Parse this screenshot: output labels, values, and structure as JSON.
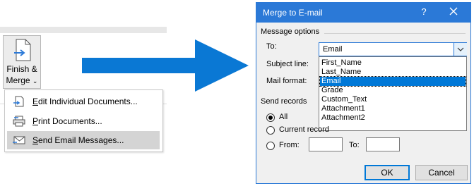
{
  "ribbon": {
    "finish_merge": {
      "label_line1": "Finish &",
      "label_line2": "Merge",
      "chevron": "⌄",
      "icon": "finish-merge-icon"
    },
    "menu": [
      {
        "label": "Edit Individual Documents...",
        "underline": "E",
        "icon": "edit-document-icon",
        "highlighted": false
      },
      {
        "label": "Print Documents...",
        "underline": "P",
        "icon": "printer-icon",
        "highlighted": false
      },
      {
        "label": "Send Email Messages...",
        "underline": "S",
        "icon": "envelope-icon",
        "highlighted": true
      }
    ]
  },
  "arrow": {
    "color": "#0a78d4",
    "icon": "right-arrow"
  },
  "dialog": {
    "title": "Merge to E-mail",
    "help": "?",
    "titlebar_color": "#2b79d7",
    "message_options_label": "Message options",
    "to_label": "To:",
    "to_value": "Email",
    "subject_label": "Subject line:",
    "mail_format_label": "Mail format:",
    "fields": [
      "First_Name",
      "Last_Name",
      "Email",
      "Grade",
      "Custom_Text",
      "Attachment1",
      "Attachment2"
    ],
    "selected_field": "Email",
    "send_records_label": "Send records",
    "radio_all": "All",
    "radio_current": "Current record",
    "radio_from": "From:",
    "to_range_label": "To:",
    "from_value": "",
    "to_range_value": "",
    "selected_radio": "All",
    "ok_label": "OK",
    "cancel_label": "Cancel"
  }
}
